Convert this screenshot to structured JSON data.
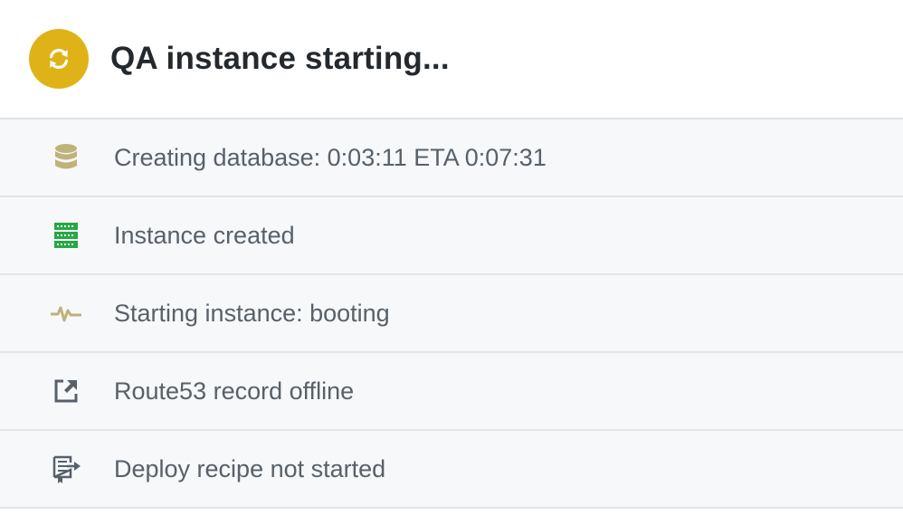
{
  "header": {
    "title": "QA instance starting...",
    "status_icon": "sync-icon",
    "status_color": "#dfb317"
  },
  "steps": [
    {
      "label": "Creating database: 0:03:11 ETA 0:07:31",
      "icon": "database-icon",
      "color": "#bfb27a"
    },
    {
      "label": "Instance created",
      "icon": "server-icon",
      "color": "#28a745"
    },
    {
      "label": "Starting instance: booting",
      "icon": "pulse-icon",
      "color": "#bfb27a"
    },
    {
      "label": "Route53 record offline",
      "icon": "link-external-icon",
      "color": "#586069"
    },
    {
      "label": "Deploy recipe not started",
      "icon": "repo-push-icon",
      "color": "#586069"
    }
  ]
}
